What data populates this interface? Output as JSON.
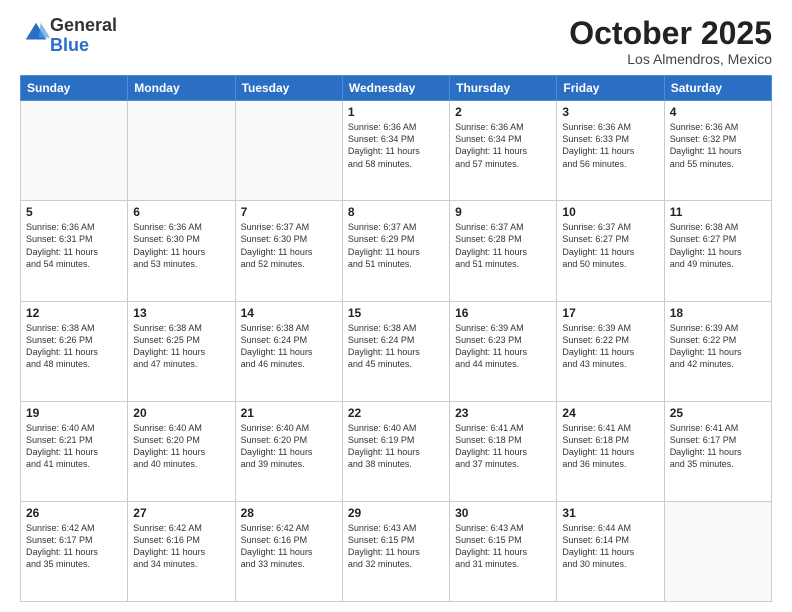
{
  "header": {
    "logo_general": "General",
    "logo_blue": "Blue",
    "month_title": "October 2025",
    "location": "Los Almendros, Mexico"
  },
  "weekdays": [
    "Sunday",
    "Monday",
    "Tuesday",
    "Wednesday",
    "Thursday",
    "Friday",
    "Saturday"
  ],
  "weeks": [
    [
      {
        "day": "",
        "text": ""
      },
      {
        "day": "",
        "text": ""
      },
      {
        "day": "",
        "text": ""
      },
      {
        "day": "1",
        "text": "Sunrise: 6:36 AM\nSunset: 6:34 PM\nDaylight: 11 hours\nand 58 minutes."
      },
      {
        "day": "2",
        "text": "Sunrise: 6:36 AM\nSunset: 6:34 PM\nDaylight: 11 hours\nand 57 minutes."
      },
      {
        "day": "3",
        "text": "Sunrise: 6:36 AM\nSunset: 6:33 PM\nDaylight: 11 hours\nand 56 minutes."
      },
      {
        "day": "4",
        "text": "Sunrise: 6:36 AM\nSunset: 6:32 PM\nDaylight: 11 hours\nand 55 minutes."
      }
    ],
    [
      {
        "day": "5",
        "text": "Sunrise: 6:36 AM\nSunset: 6:31 PM\nDaylight: 11 hours\nand 54 minutes."
      },
      {
        "day": "6",
        "text": "Sunrise: 6:36 AM\nSunset: 6:30 PM\nDaylight: 11 hours\nand 53 minutes."
      },
      {
        "day": "7",
        "text": "Sunrise: 6:37 AM\nSunset: 6:30 PM\nDaylight: 11 hours\nand 52 minutes."
      },
      {
        "day": "8",
        "text": "Sunrise: 6:37 AM\nSunset: 6:29 PM\nDaylight: 11 hours\nand 51 minutes."
      },
      {
        "day": "9",
        "text": "Sunrise: 6:37 AM\nSunset: 6:28 PM\nDaylight: 11 hours\nand 51 minutes."
      },
      {
        "day": "10",
        "text": "Sunrise: 6:37 AM\nSunset: 6:27 PM\nDaylight: 11 hours\nand 50 minutes."
      },
      {
        "day": "11",
        "text": "Sunrise: 6:38 AM\nSunset: 6:27 PM\nDaylight: 11 hours\nand 49 minutes."
      }
    ],
    [
      {
        "day": "12",
        "text": "Sunrise: 6:38 AM\nSunset: 6:26 PM\nDaylight: 11 hours\nand 48 minutes."
      },
      {
        "day": "13",
        "text": "Sunrise: 6:38 AM\nSunset: 6:25 PM\nDaylight: 11 hours\nand 47 minutes."
      },
      {
        "day": "14",
        "text": "Sunrise: 6:38 AM\nSunset: 6:24 PM\nDaylight: 11 hours\nand 46 minutes."
      },
      {
        "day": "15",
        "text": "Sunrise: 6:38 AM\nSunset: 6:24 PM\nDaylight: 11 hours\nand 45 minutes."
      },
      {
        "day": "16",
        "text": "Sunrise: 6:39 AM\nSunset: 6:23 PM\nDaylight: 11 hours\nand 44 minutes."
      },
      {
        "day": "17",
        "text": "Sunrise: 6:39 AM\nSunset: 6:22 PM\nDaylight: 11 hours\nand 43 minutes."
      },
      {
        "day": "18",
        "text": "Sunrise: 6:39 AM\nSunset: 6:22 PM\nDaylight: 11 hours\nand 42 minutes."
      }
    ],
    [
      {
        "day": "19",
        "text": "Sunrise: 6:40 AM\nSunset: 6:21 PM\nDaylight: 11 hours\nand 41 minutes."
      },
      {
        "day": "20",
        "text": "Sunrise: 6:40 AM\nSunset: 6:20 PM\nDaylight: 11 hours\nand 40 minutes."
      },
      {
        "day": "21",
        "text": "Sunrise: 6:40 AM\nSunset: 6:20 PM\nDaylight: 11 hours\nand 39 minutes."
      },
      {
        "day": "22",
        "text": "Sunrise: 6:40 AM\nSunset: 6:19 PM\nDaylight: 11 hours\nand 38 minutes."
      },
      {
        "day": "23",
        "text": "Sunrise: 6:41 AM\nSunset: 6:18 PM\nDaylight: 11 hours\nand 37 minutes."
      },
      {
        "day": "24",
        "text": "Sunrise: 6:41 AM\nSunset: 6:18 PM\nDaylight: 11 hours\nand 36 minutes."
      },
      {
        "day": "25",
        "text": "Sunrise: 6:41 AM\nSunset: 6:17 PM\nDaylight: 11 hours\nand 35 minutes."
      }
    ],
    [
      {
        "day": "26",
        "text": "Sunrise: 6:42 AM\nSunset: 6:17 PM\nDaylight: 11 hours\nand 35 minutes."
      },
      {
        "day": "27",
        "text": "Sunrise: 6:42 AM\nSunset: 6:16 PM\nDaylight: 11 hours\nand 34 minutes."
      },
      {
        "day": "28",
        "text": "Sunrise: 6:42 AM\nSunset: 6:16 PM\nDaylight: 11 hours\nand 33 minutes."
      },
      {
        "day": "29",
        "text": "Sunrise: 6:43 AM\nSunset: 6:15 PM\nDaylight: 11 hours\nand 32 minutes."
      },
      {
        "day": "30",
        "text": "Sunrise: 6:43 AM\nSunset: 6:15 PM\nDaylight: 11 hours\nand 31 minutes."
      },
      {
        "day": "31",
        "text": "Sunrise: 6:44 AM\nSunset: 6:14 PM\nDaylight: 11 hours\nand 30 minutes."
      },
      {
        "day": "",
        "text": ""
      }
    ]
  ]
}
